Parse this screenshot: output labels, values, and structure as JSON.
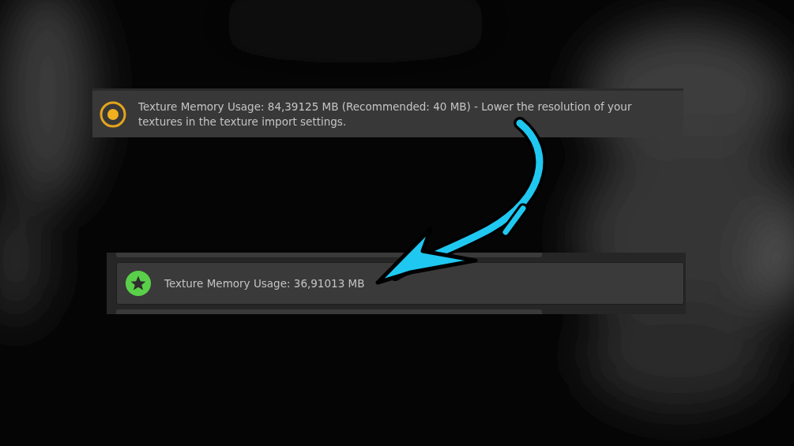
{
  "messages": [
    {
      "kind": "warning",
      "text": "Texture Memory Usage: 84,39125 MB (Recommended: 40 MB) - Lower the resolution of your textures in the texture import settings."
    },
    {
      "kind": "success",
      "text": "Texture Memory Usage: 36,91013 MB"
    }
  ]
}
